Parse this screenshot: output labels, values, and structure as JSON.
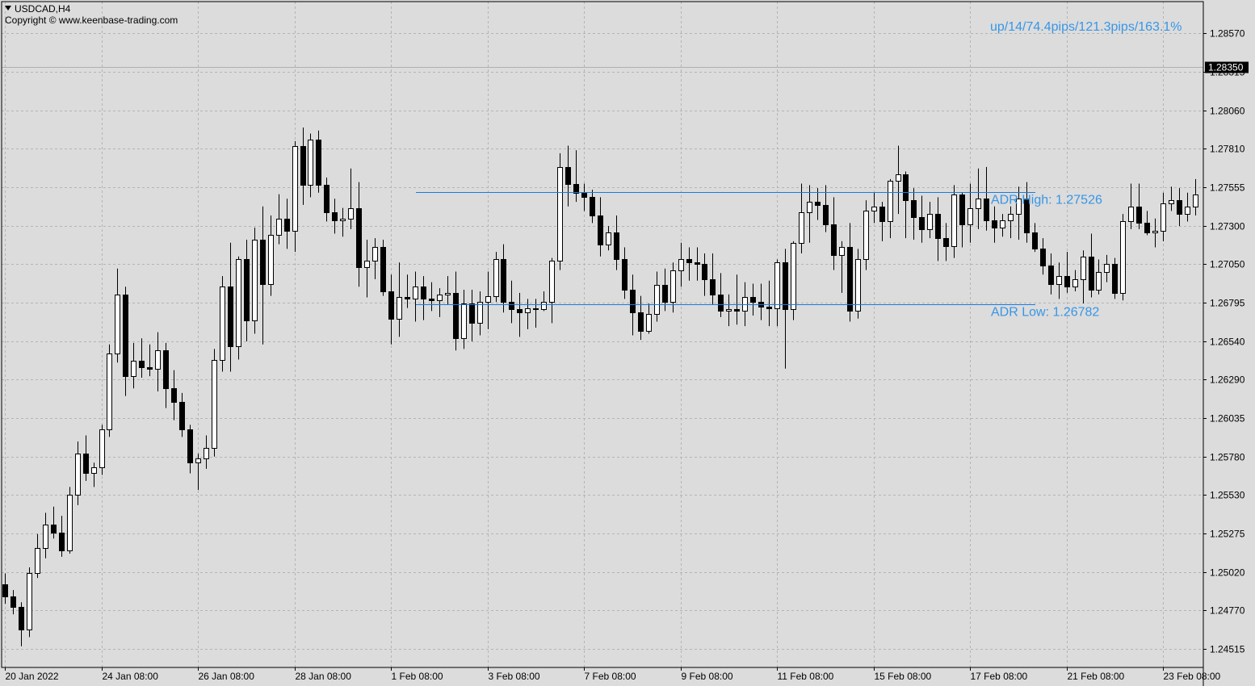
{
  "header": {
    "symbol_timeframe": "USDCAD,H4",
    "copyright": "Copyright © www.keenbase-trading.com"
  },
  "colors": {
    "background": "#dcdcdc",
    "grid": "#b4b4b4",
    "candle": "#000000",
    "bull_fill": "#ffffff",
    "bear_fill": "#000000",
    "adr_line": "#1e78dc",
    "adr_text": "#3796e6",
    "price_tag_bg": "#000000",
    "price_tag_text": "#ffffff"
  },
  "chart_data": {
    "type": "candlestick",
    "symbol": "USDCAD",
    "timeframe": "H4",
    "grid": true,
    "ylim": [
      1.2439,
      1.2878
    ],
    "y_ticks": [
      "1.28570",
      "1.28315",
      "1.28060",
      "1.27810",
      "1.27555",
      "1.27300",
      "1.27050",
      "1.26795",
      "1.26540",
      "1.26290",
      "1.26035",
      "1.25780",
      "1.25530",
      "1.25275",
      "1.25020",
      "1.24770",
      "1.24515"
    ],
    "x_ticks": [
      {
        "index": 0,
        "label": "20 Jan 2022"
      },
      {
        "index": 12,
        "label": "24 Jan 08:00"
      },
      {
        "index": 24,
        "label": "26 Jan 08:00"
      },
      {
        "index": 36,
        "label": "28 Jan 08:00"
      },
      {
        "index": 48,
        "label": "1 Feb 08:00"
      },
      {
        "index": 60,
        "label": "3 Feb 08:00"
      },
      {
        "index": 72,
        "label": "7 Feb 08:00"
      },
      {
        "index": 84,
        "label": "9 Feb 08:00"
      },
      {
        "index": 96,
        "label": "11 Feb 08:00"
      },
      {
        "index": 108,
        "label": "15 Feb 08:00"
      },
      {
        "index": 120,
        "label": "17 Feb 08:00"
      },
      {
        "index": 132,
        "label": "21 Feb 08:00"
      },
      {
        "index": 144,
        "label": "23 Feb 08:00"
      }
    ],
    "current_price": "1.28350",
    "adr_high": {
      "label": "ADR High: 1.27526",
      "value": 1.27526
    },
    "adr_low": {
      "label": "ADR Low: 1.26782",
      "value": 1.26782
    },
    "adr_stats": "up/14/74.4pips/121.3pips/163.1%",
    "candles": [
      [
        1.2494,
        1.2501,
        1.2481,
        1.2486
      ],
      [
        1.2486,
        1.249,
        1.2474,
        1.2479
      ],
      [
        1.2479,
        1.2482,
        1.2453,
        1.2464
      ],
      [
        1.2464,
        1.2505,
        1.2459,
        1.2501
      ],
      [
        1.2501,
        1.2527,
        1.2498,
        1.2518
      ],
      [
        1.2518,
        1.2541,
        1.2511,
        1.2533
      ],
      [
        1.2533,
        1.2545,
        1.2524,
        1.2528
      ],
      [
        1.2528,
        1.2539,
        1.2512,
        1.2516
      ],
      [
        1.2516,
        1.2558,
        1.2514,
        1.2553
      ],
      [
        1.2553,
        1.2588,
        1.2546,
        1.258
      ],
      [
        1.258,
        1.2592,
        1.2562,
        1.2567
      ],
      [
        1.2567,
        1.2574,
        1.2558,
        1.2571
      ],
      [
        1.2571,
        1.2599,
        1.2566,
        1.2596
      ],
      [
        1.2596,
        1.2652,
        1.2591,
        1.2646
      ],
      [
        1.2646,
        1.2702,
        1.264,
        1.2685
      ],
      [
        1.2685,
        1.269,
        1.2618,
        1.2631
      ],
      [
        1.2631,
        1.2653,
        1.2623,
        1.2641
      ],
      [
        1.2641,
        1.2656,
        1.263,
        1.2637
      ],
      [
        1.2637,
        1.2652,
        1.2631,
        1.2636
      ],
      [
        1.2636,
        1.266,
        1.2621,
        1.2648
      ],
      [
        1.2648,
        1.2653,
        1.261,
        1.2623
      ],
      [
        1.2623,
        1.2635,
        1.2602,
        1.2614
      ],
      [
        1.2614,
        1.262,
        1.2591,
        1.2596
      ],
      [
        1.2596,
        1.2599,
        1.2567,
        1.2574
      ],
      [
        1.2574,
        1.258,
        1.2556,
        1.2577
      ],
      [
        1.2577,
        1.2592,
        1.257,
        1.2584
      ],
      [
        1.2584,
        1.2649,
        1.2578,
        1.2642
      ],
      [
        1.2642,
        1.2697,
        1.2634,
        1.269
      ],
      [
        1.269,
        1.2719,
        1.2634,
        1.2651
      ],
      [
        1.2651,
        1.271,
        1.2642,
        1.2708
      ],
      [
        1.2708,
        1.2721,
        1.2654,
        1.2668
      ],
      [
        1.2668,
        1.2729,
        1.2659,
        1.2721
      ],
      [
        1.2721,
        1.2743,
        1.2652,
        1.2692
      ],
      [
        1.2692,
        1.2737,
        1.2684,
        1.2724
      ],
      [
        1.2724,
        1.2751,
        1.2718,
        1.2735
      ],
      [
        1.2735,
        1.2748,
        1.2715,
        1.2727
      ],
      [
        1.2727,
        1.2786,
        1.2713,
        1.2783
      ],
      [
        1.2783,
        1.2795,
        1.2744,
        1.2757
      ],
      [
        1.2757,
        1.2791,
        1.2749,
        1.2787
      ],
      [
        1.2787,
        1.2793,
        1.2752,
        1.2757
      ],
      [
        1.2757,
        1.2762,
        1.2733,
        1.2739
      ],
      [
        1.2739,
        1.2748,
        1.2725,
        1.2734
      ],
      [
        1.2734,
        1.2742,
        1.2723,
        1.2735
      ],
      [
        1.2735,
        1.2768,
        1.2728,
        1.2742
      ],
      [
        1.2742,
        1.2759,
        1.269,
        1.2703
      ],
      [
        1.2703,
        1.2721,
        1.2683,
        1.2707
      ],
      [
        1.2707,
        1.2722,
        1.2695,
        1.2716
      ],
      [
        1.2716,
        1.2721,
        1.2684,
        1.2687
      ],
      [
        1.2687,
        1.2698,
        1.2652,
        1.2669
      ],
      [
        1.2669,
        1.2706,
        1.2657,
        1.2683
      ],
      [
        1.2683,
        1.2698,
        1.2676,
        1.2682
      ],
      [
        1.2682,
        1.27,
        1.2667,
        1.269
      ],
      [
        1.269,
        1.2697,
        1.2668,
        1.2682
      ],
      [
        1.2682,
        1.2693,
        1.2674,
        1.2681
      ],
      [
        1.2681,
        1.2689,
        1.267,
        1.2685
      ],
      [
        1.2685,
        1.2697,
        1.2678,
        1.2686
      ],
      [
        1.2686,
        1.27,
        1.2648,
        1.2656
      ],
      [
        1.2656,
        1.2688,
        1.2649,
        1.2679
      ],
      [
        1.2679,
        1.2688,
        1.2654,
        1.2666
      ],
      [
        1.2666,
        1.2687,
        1.2658,
        1.268
      ],
      [
        1.268,
        1.27,
        1.2662,
        1.2684
      ],
      [
        1.2684,
        1.2713,
        1.268,
        1.2708
      ],
      [
        1.2708,
        1.2718,
        1.2673,
        1.268
      ],
      [
        1.268,
        1.2694,
        1.2666,
        1.2675
      ],
      [
        1.2675,
        1.2686,
        1.2657,
        1.2673
      ],
      [
        1.2673,
        1.2682,
        1.2662,
        1.2676
      ],
      [
        1.2676,
        1.2682,
        1.2663,
        1.2675
      ],
      [
        1.2675,
        1.2687,
        1.2674,
        1.268
      ],
      [
        1.268,
        1.2709,
        1.2666,
        1.2707
      ],
      [
        1.2707,
        1.2778,
        1.2701,
        1.2769
      ],
      [
        1.2769,
        1.2783,
        1.2743,
        1.2758
      ],
      [
        1.2758,
        1.278,
        1.2746,
        1.2752
      ],
      [
        1.2752,
        1.2758,
        1.274,
        1.2749
      ],
      [
        1.2749,
        1.2754,
        1.2732,
        1.2737
      ],
      [
        1.2737,
        1.2749,
        1.271,
        1.2718
      ],
      [
        1.2718,
        1.273,
        1.2714,
        1.2726
      ],
      [
        1.2726,
        1.2737,
        1.2701,
        1.2708
      ],
      [
        1.2708,
        1.2716,
        1.2682,
        1.2688
      ],
      [
        1.2688,
        1.2698,
        1.2658,
        1.2673
      ],
      [
        1.2673,
        1.2684,
        1.2655,
        1.2661
      ],
      [
        1.2661,
        1.2679,
        1.2659,
        1.2672
      ],
      [
        1.2672,
        1.27,
        1.2667,
        1.2691
      ],
      [
        1.2691,
        1.2702,
        1.2674,
        1.268
      ],
      [
        1.268,
        1.2706,
        1.2673,
        1.2701
      ],
      [
        1.2701,
        1.2719,
        1.269,
        1.2708
      ],
      [
        1.2708,
        1.2716,
        1.2694,
        1.2706
      ],
      [
        1.2706,
        1.2716,
        1.2694,
        1.2705
      ],
      [
        1.2705,
        1.2712,
        1.2684,
        1.2695
      ],
      [
        1.2695,
        1.2712,
        1.2678,
        1.2685
      ],
      [
        1.2685,
        1.2699,
        1.267,
        1.2674
      ],
      [
        1.2674,
        1.2685,
        1.2664,
        1.2675
      ],
      [
        1.2675,
        1.2698,
        1.2665,
        1.2674
      ],
      [
        1.2674,
        1.2693,
        1.2664,
        1.2683
      ],
      [
        1.2683,
        1.2692,
        1.2671,
        1.268
      ],
      [
        1.268,
        1.2692,
        1.2668,
        1.2677
      ],
      [
        1.2677,
        1.2694,
        1.2664,
        1.2676
      ],
      [
        1.2676,
        1.2708,
        1.2664,
        1.2706
      ],
      [
        1.2706,
        1.2715,
        1.2636,
        1.2675
      ],
      [
        1.2675,
        1.272,
        1.2668,
        1.2719
      ],
      [
        1.2719,
        1.2758,
        1.2712,
        1.2739
      ],
      [
        1.2739,
        1.2757,
        1.2719,
        1.2746
      ],
      [
        1.2746,
        1.2755,
        1.2734,
        1.2744
      ],
      [
        1.2744,
        1.2757,
        1.2726,
        1.2731
      ],
      [
        1.2731,
        1.2749,
        1.2701,
        1.2711
      ],
      [
        1.2711,
        1.272,
        1.2686,
        1.2716
      ],
      [
        1.2716,
        1.2732,
        1.2667,
        1.2674
      ],
      [
        1.2674,
        1.2715,
        1.2669,
        1.2708
      ],
      [
        1.2708,
        1.2747,
        1.2701,
        1.274
      ],
      [
        1.274,
        1.2752,
        1.2732,
        1.2743
      ],
      [
        1.2743,
        1.2746,
        1.272,
        1.2733
      ],
      [
        1.2733,
        1.2761,
        1.2722,
        1.276
      ],
      [
        1.276,
        1.2783,
        1.2738,
        1.2764
      ],
      [
        1.2764,
        1.2766,
        1.2722,
        1.2747
      ],
      [
        1.2747,
        1.2755,
        1.2721,
        1.2736
      ],
      [
        1.2736,
        1.275,
        1.2719,
        1.2728
      ],
      [
        1.2728,
        1.2746,
        1.2722,
        1.2738
      ],
      [
        1.2738,
        1.2749,
        1.2707,
        1.2722
      ],
      [
        1.2722,
        1.2732,
        1.2707,
        1.2717
      ],
      [
        1.2717,
        1.2757,
        1.2709,
        1.2751
      ],
      [
        1.2751,
        1.2752,
        1.2716,
        1.2731
      ],
      [
        1.2731,
        1.2758,
        1.2719,
        1.2742
      ],
      [
        1.2742,
        1.2768,
        1.2728,
        1.2748
      ],
      [
        1.2748,
        1.2769,
        1.2727,
        1.2734
      ],
      [
        1.2734,
        1.2743,
        1.2719,
        1.2729
      ],
      [
        1.2729,
        1.2738,
        1.2723,
        1.2734
      ],
      [
        1.2734,
        1.2743,
        1.2722,
        1.2738
      ],
      [
        1.2738,
        1.2756,
        1.2721,
        1.2748
      ],
      [
        1.2748,
        1.2759,
        1.2719,
        1.2726
      ],
      [
        1.2726,
        1.2732,
        1.2713,
        1.2715
      ],
      [
        1.2715,
        1.2722,
        1.2698,
        1.2704
      ],
      [
        1.2704,
        1.2712,
        1.2685,
        1.2692
      ],
      [
        1.2692,
        1.2706,
        1.2682,
        1.2697
      ],
      [
        1.2697,
        1.2713,
        1.2686,
        1.269
      ],
      [
        1.269,
        1.2701,
        1.2687,
        1.2695
      ],
      [
        1.2695,
        1.2714,
        1.2679,
        1.271
      ],
      [
        1.271,
        1.2725,
        1.2683,
        1.2688
      ],
      [
        1.2688,
        1.2708,
        1.2685,
        1.27
      ],
      [
        1.27,
        1.2711,
        1.2693,
        1.2705
      ],
      [
        1.2705,
        1.2709,
        1.2682,
        1.2686
      ],
      [
        1.2686,
        1.2738,
        1.2681,
        1.2733
      ],
      [
        1.2733,
        1.2758,
        1.2728,
        1.2743
      ],
      [
        1.2743,
        1.2758,
        1.2728,
        1.2732
      ],
      [
        1.2732,
        1.274,
        1.2724,
        1.2726
      ],
      [
        1.2726,
        1.2735,
        1.2716,
        1.2727
      ],
      [
        1.2727,
        1.2752,
        1.272,
        1.2745
      ],
      [
        1.2745,
        1.2756,
        1.274,
        1.2747
      ],
      [
        1.2747,
        1.2755,
        1.273,
        1.2738
      ],
      [
        1.2738,
        1.2752,
        1.2733,
        1.2743
      ],
      [
        1.2743,
        1.2761,
        1.2737,
        1.2751
      ]
    ]
  }
}
